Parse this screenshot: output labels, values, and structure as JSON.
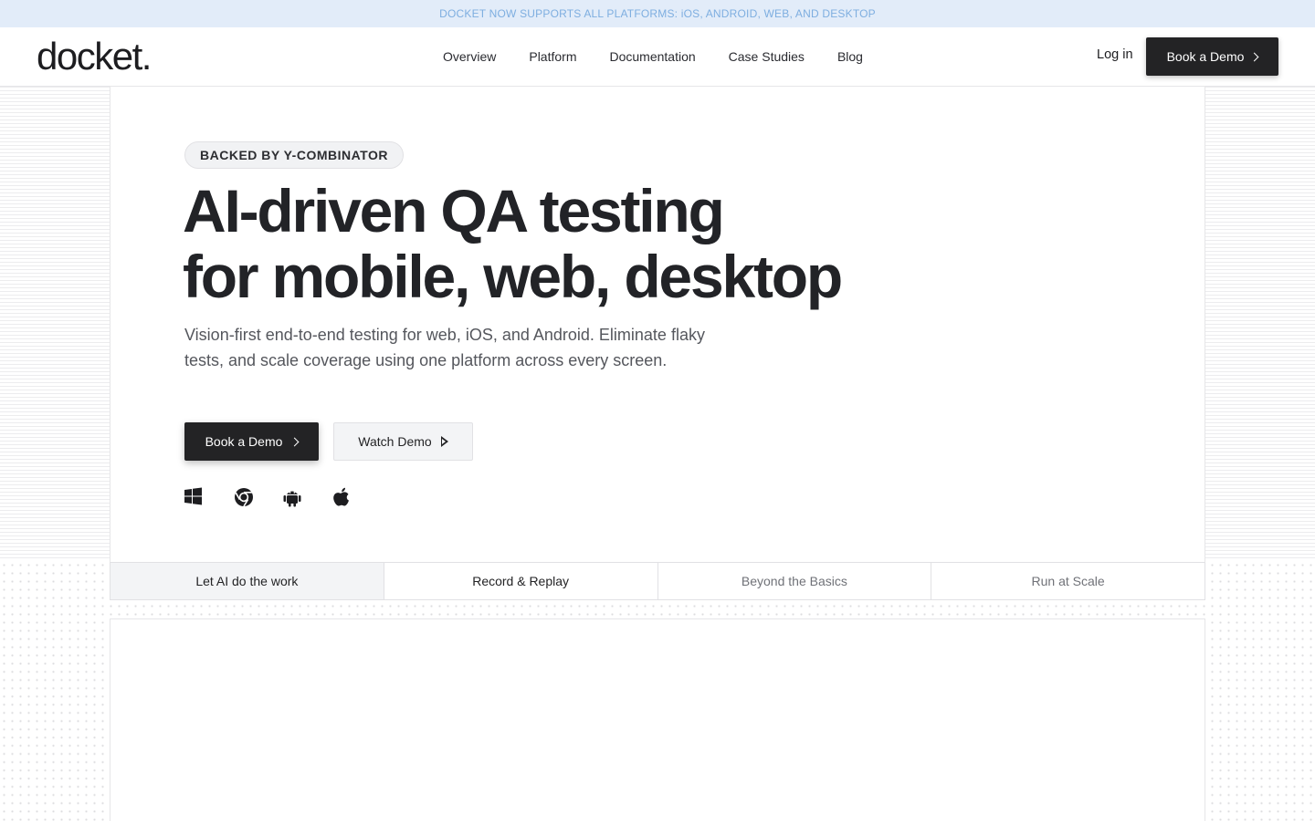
{
  "announcement": "DOCKET NOW SUPPORTS ALL PLATFORMS: iOS, ANDROID, WEB, AND DESKTOP",
  "header": {
    "logo": "docket.",
    "nav": [
      {
        "label": "Overview"
      },
      {
        "label": "Platform"
      },
      {
        "label": "Documentation"
      },
      {
        "label": "Case Studies"
      },
      {
        "label": "Blog"
      }
    ],
    "login": "Log in",
    "cta": "Book a Demo"
  },
  "hero": {
    "badge": "BACKED BY Y-COMBINATOR",
    "title_line1": "AI-driven QA testing",
    "title_line2": "for mobile, web, desktop",
    "subtitle": "Vision-first end-to-end testing for web, iOS, and Android. Eliminate flaky tests, and scale coverage using one platform across every screen.",
    "primary_button": "Book a Demo",
    "secondary_button": "Watch Demo",
    "platform_icons": [
      "windows-icon",
      "chrome-icon",
      "android-icon",
      "apple-icon"
    ]
  },
  "tabs": [
    {
      "label": "Let AI do the work",
      "active": true
    },
    {
      "label": "Record & Replay",
      "active": false
    },
    {
      "label": "Beyond the Basics",
      "active": false
    },
    {
      "label": "Run at Scale",
      "active": false
    }
  ],
  "colors": {
    "announcement_bg": "#e2ecf9",
    "announcement_text": "#7eaee0",
    "dark_button": "#232325",
    "text": "#222327"
  }
}
